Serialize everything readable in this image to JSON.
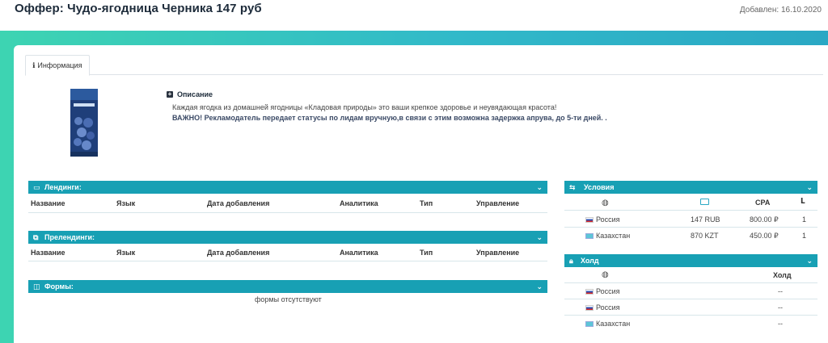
{
  "header": {
    "title": "Оффер: Чудо-ягодница Черника 147 руб",
    "date_added": "Добавлен: 16.10.2020"
  },
  "tabs": [
    {
      "label": "Информация",
      "icon": "info-icon"
    }
  ],
  "description": {
    "heading": "Описание",
    "text": "Каждая ягодка из домашней ягодницы «Кладовая природы» это ваши крепкое здоровье и неувядающая красота!",
    "warning": "ВАЖНО! Рекламодатель передает статусы по лидам вручную,в связи с этим возможна задержка апрува, до 5-ти дней. ."
  },
  "landings": {
    "title": "Лендинги:",
    "columns": [
      "Название",
      "Язык",
      "Дата добавления",
      "Аналитика",
      "Тип",
      "Управление"
    ]
  },
  "prelandings": {
    "title": "Прелендинги:",
    "columns": [
      "Название",
      "Язык",
      "Дата добавления",
      "Аналитика",
      "Тип",
      "Управление"
    ]
  },
  "forms": {
    "title": "Формы:",
    "empty": "формы отсутствуют"
  },
  "conditions": {
    "title": "Условия",
    "columns": {
      "cpa": "CPA"
    },
    "rows": [
      {
        "country": "Россия",
        "flag": "ru",
        "price": "147 RUB",
        "cpa": "800.00 ₽",
        "limit": "1"
      },
      {
        "country": "Казахстан",
        "flag": "kz",
        "price": "870 KZT",
        "cpa": "450.00 ₽",
        "limit": "1"
      }
    ]
  },
  "hold": {
    "title": "Холд",
    "column": "Холд",
    "rows": [
      {
        "country": "Россия",
        "flag": "ru",
        "value": "--"
      },
      {
        "country": "Россия",
        "flag": "ru",
        "value": "--"
      },
      {
        "country": "Казахстан",
        "flag": "kz",
        "value": "--"
      }
    ]
  },
  "colors": {
    "accent": "#18a0b4",
    "gradient_start": "#3dd4b2",
    "gradient_end": "#2aa8c4"
  }
}
